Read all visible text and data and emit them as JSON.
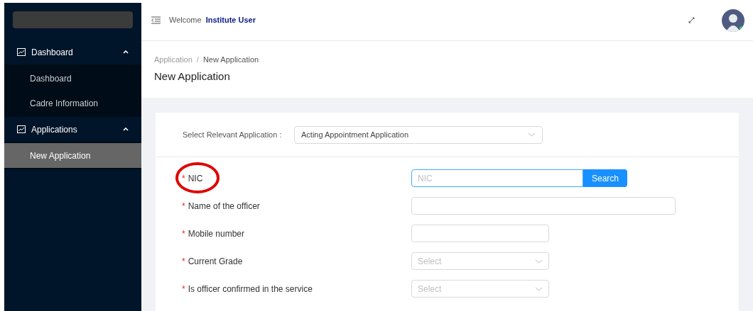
{
  "header": {
    "welcome": "Welcome",
    "user": "Institute User"
  },
  "sidebar": {
    "groups": [
      {
        "label": "Dashboard",
        "expanded": true,
        "items": [
          {
            "label": "Dashboard",
            "selected": false
          },
          {
            "label": "Cadre Information",
            "selected": false
          }
        ]
      },
      {
        "label": "Applications",
        "expanded": true,
        "items": [
          {
            "label": "New Application",
            "selected": true
          }
        ]
      }
    ]
  },
  "breadcrumb": {
    "items": [
      "Application",
      "New Application"
    ],
    "separator": "/"
  },
  "page_title": "New Application",
  "application_select": {
    "label": "Select Relevant Application :",
    "value": "Acting Appointment Application"
  },
  "fields": [
    {
      "kind": "search",
      "mark": "*",
      "label": "NIC",
      "placeholder": "NIC",
      "button": "Search",
      "circled": true
    },
    {
      "kind": "wide_text",
      "mark": "*",
      "label": "Name of the officer"
    },
    {
      "kind": "text",
      "mark": "*",
      "label": "Mobile number"
    },
    {
      "kind": "select",
      "mark": "*",
      "label": "Current Grade",
      "placeholder": "Select"
    },
    {
      "kind": "select",
      "mark": "*",
      "label": "Is officer confirmed in the service",
      "placeholder": "Select"
    }
  ]
}
